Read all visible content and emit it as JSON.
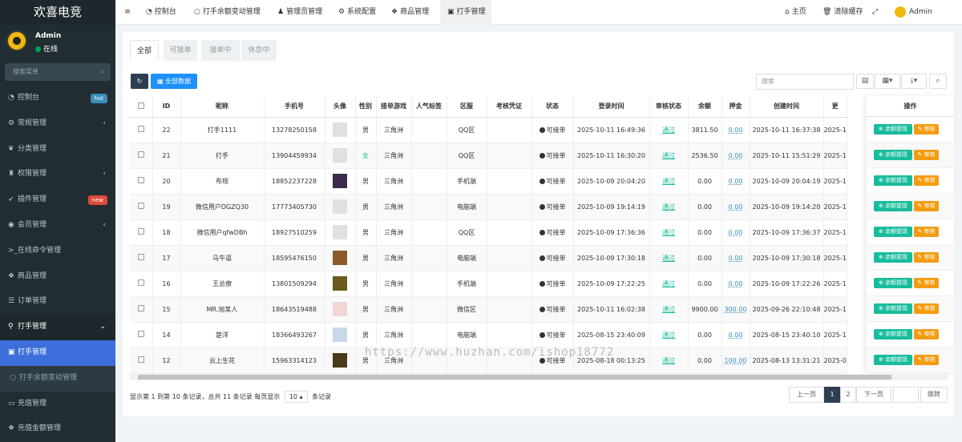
{
  "app": {
    "brand": "欢喜电竞"
  },
  "user": {
    "name": "Admin",
    "status": "在线"
  },
  "sidebar": {
    "search_placeholder": "搜索菜单",
    "items": [
      {
        "label": "控制台",
        "icon": "dashboard-icon",
        "badge": "hot",
        "badge_color": "#3c8dbc"
      },
      {
        "label": "常规管理",
        "icon": "cogs-icon",
        "arrow": "‹"
      },
      {
        "label": "分类管理",
        "icon": "leaf-icon"
      },
      {
        "label": "权限管理",
        "icon": "group-icon",
        "arrow": "‹"
      },
      {
        "label": "插件管理",
        "icon": "rocket-icon",
        "badge": "new",
        "badge_color": "#dd4b39"
      },
      {
        "label": "会员管理",
        "icon": "user-circle-icon",
        "arrow": "‹"
      },
      {
        "label": "在线命令管理",
        "icon": "terminal-icon"
      },
      {
        "label": "商品管理",
        "icon": "cubes-icon"
      },
      {
        "label": "订单管理",
        "icon": "list-icon"
      },
      {
        "label": "打手管理",
        "icon": "pin-icon",
        "arrow": "⌄"
      },
      {
        "label": "打手管理",
        "icon": "square-icon"
      },
      {
        "label": "打手余额变动管理",
        "icon": "circle-icon"
      },
      {
        "label": "充值管理",
        "icon": "card-icon"
      },
      {
        "label": "充值金额管理",
        "icon": "cubes-icon"
      }
    ]
  },
  "topbar": {
    "menu_icon": "≡",
    "tabs": [
      {
        "label": "控制台",
        "icon": "dashboard-icon"
      },
      {
        "label": "打手余额变动管理",
        "icon": "circle-icon"
      },
      {
        "label": "管理员管理",
        "icon": "user-icon"
      },
      {
        "label": "系统配置",
        "icon": "gear-icon"
      },
      {
        "label": "商品管理",
        "icon": "cubes-icon"
      },
      {
        "label": "打手管理",
        "icon": "square-icon"
      }
    ],
    "right": {
      "home": "主页",
      "clear_cache": "清除缓存",
      "admin": "Admin"
    }
  },
  "filter_tabs": [
    "全部",
    "可接单",
    "接单中",
    "休息中"
  ],
  "toolbar": {
    "refresh": "↻",
    "all_data": "全部数据",
    "search_placeholder": "搜索"
  },
  "table": {
    "headers": [
      "ID",
      "昵称",
      "手机号",
      "头像",
      "性别",
      "接单游戏",
      "人气标签",
      "区服",
      "考核凭证",
      "状态",
      "登录时间",
      "审核状态",
      "余额",
      "押金",
      "创建时间",
      "更"
    ],
    "rows": [
      {
        "id": "22",
        "nick": "打手1111",
        "phone": "13278250158",
        "gender": "男",
        "game": "三角洲",
        "tag": "",
        "server": "QQ区",
        "cert": "",
        "status": "可接单",
        "login": "2025-10-11 16:49:36",
        "audit": "通过",
        "balance": "3811.50",
        "deposit": "0.00",
        "created": "2025-10-11 16:37:38",
        "upd": "2025-1"
      },
      {
        "id": "21",
        "nick": "打手",
        "phone": "13904459934",
        "gender": "女",
        "game": "三角洲",
        "tag": "",
        "server": "QQ区",
        "cert": "",
        "status": "可接单",
        "login": "2025-10-11 16:30:20",
        "audit": "通过",
        "balance": "2536.50",
        "deposit": "0.00",
        "created": "2025-10-11 15:51:29",
        "upd": "2025-1"
      },
      {
        "id": "20",
        "nick": "布规",
        "phone": "18852237228",
        "gender": "男",
        "game": "三角洲",
        "tag": "",
        "server": "手机端",
        "cert": "",
        "status": "可接单",
        "login": "2025-10-09 20:04:20",
        "audit": "通过",
        "balance": "0.00",
        "deposit": "0.00",
        "created": "2025-10-09 20:04:19",
        "upd": "2025-1"
      },
      {
        "id": "19",
        "nick": "微信用户DGZQ30",
        "phone": "17773405730",
        "gender": "男",
        "game": "三角洲",
        "tag": "",
        "server": "电脑端",
        "cert": "",
        "status": "可接单",
        "login": "2025-10-09 19:14:19",
        "audit": "通过",
        "balance": "0.00",
        "deposit": "0.00",
        "created": "2025-10-09 19:14:20",
        "upd": "2025-1"
      },
      {
        "id": "18",
        "nick": "微信用户qfwDBh",
        "phone": "18927510259",
        "gender": "男",
        "game": "三角洲",
        "tag": "",
        "server": "QQ区",
        "cert": "",
        "status": "可接单",
        "login": "2025-10-09 17:36:36",
        "audit": "通过",
        "balance": "0.00",
        "deposit": "0.00",
        "created": "2025-10-09 17:36:37",
        "upd": "2025-1"
      },
      {
        "id": "17",
        "nick": "马牛逼",
        "phone": "18595476150",
        "gender": "男",
        "game": "三角洲",
        "tag": "",
        "server": "电脑端",
        "cert": "",
        "status": "可接单",
        "login": "2025-10-09 17:30:18",
        "audit": "通过",
        "balance": "0.00",
        "deposit": "0.00",
        "created": "2025-10-09 17:30:18",
        "upd": "2025-1"
      },
      {
        "id": "16",
        "nick": "王总僚",
        "phone": "13801509294",
        "gender": "男",
        "game": "三角洲",
        "tag": "",
        "server": "手机端",
        "cert": "",
        "status": "可接单",
        "login": "2025-10-09 17:22:25",
        "audit": "通过",
        "balance": "0.00",
        "deposit": "0.00",
        "created": "2025-10-09 17:22:26",
        "upd": "2025-1"
      },
      {
        "id": "15",
        "nick": "MR.旭某人",
        "phone": "18643519488",
        "gender": "男",
        "game": "三角洲",
        "tag": "",
        "server": "微信区",
        "cert": "",
        "status": "可接单",
        "login": "2025-10-11 16:02:38",
        "audit": "通过",
        "balance": "9900.00",
        "deposit": "300.00",
        "created": "2025-09-26 22:10:48",
        "upd": "2025-1"
      },
      {
        "id": "14",
        "nick": "楚洋",
        "phone": "18366493267",
        "gender": "男",
        "game": "三角洲",
        "tag": "",
        "server": "电脑端",
        "cert": "",
        "status": "可接单",
        "login": "2025-08-15 23:40:09",
        "audit": "通过",
        "balance": "0.00",
        "deposit": "0.00",
        "created": "2025-08-15 23:40:10",
        "upd": "2025-1"
      },
      {
        "id": "12",
        "nick": "云上生花",
        "phone": "15963314123",
        "gender": "男",
        "game": "三角洲",
        "tag": "",
        "server": "",
        "cert": "",
        "status": "可接单",
        "login": "2025-08-18 00:13:25",
        "audit": "通过",
        "balance": "0.00",
        "deposit": "100.00",
        "created": "2025-08-13 13:31:21",
        "upd": "2025-0"
      }
    ]
  },
  "ops": {
    "header": "操作",
    "withdraw": "余额提现",
    "audit": "审核"
  },
  "footer": {
    "summary_pre": "显示第 1 到第 10 条记录，总共 11 条记录 每页显示",
    "per_page": "10",
    "summary_post": "条记录"
  },
  "pagination": {
    "prev": "上一页",
    "p1": "1",
    "p2": "2",
    "next": "下一页",
    "jump": "跳转"
  },
  "watermark": "https://www.huzhan.com/ishop18772"
}
